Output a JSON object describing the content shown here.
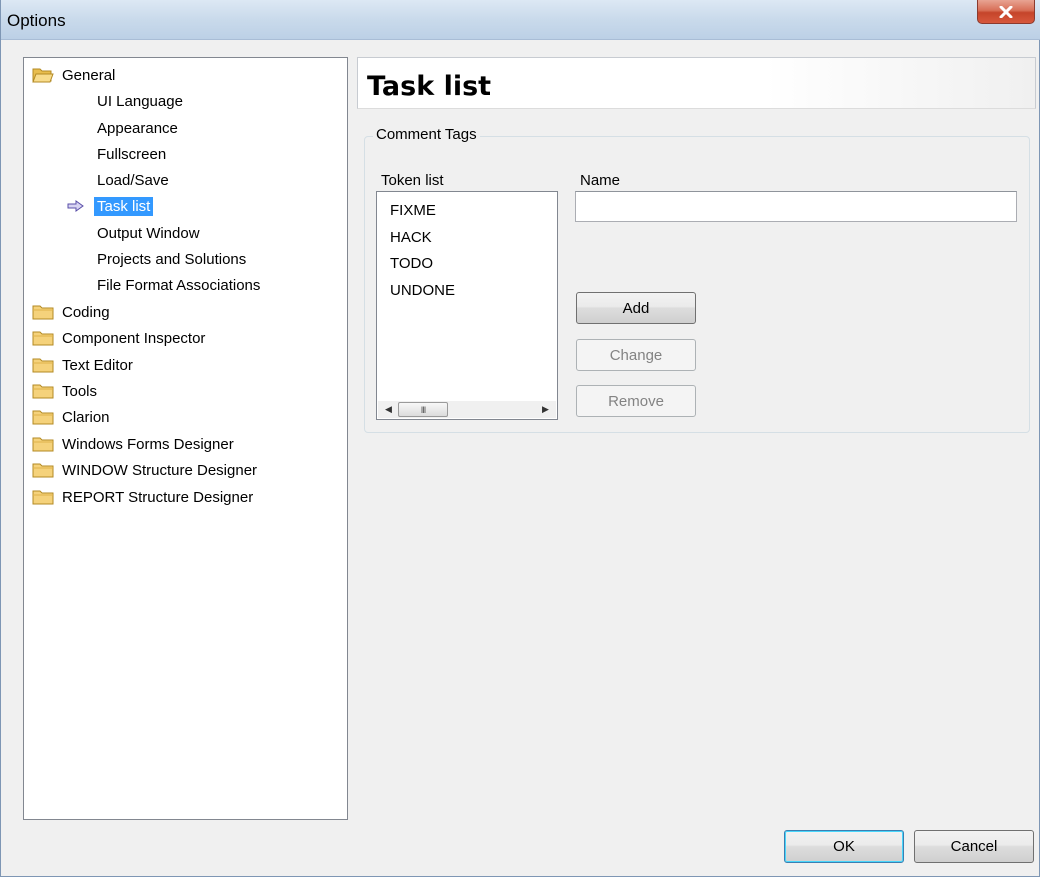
{
  "window": {
    "title": "Options"
  },
  "tree": {
    "general": {
      "label": "General",
      "children": [
        {
          "label": "UI Language"
        },
        {
          "label": "Appearance"
        },
        {
          "label": "Fullscreen"
        },
        {
          "label": "Load/Save"
        },
        {
          "label": "Task list",
          "selected": true
        },
        {
          "label": "Output Window"
        },
        {
          "label": "Projects and Solutions"
        },
        {
          "label": "File Format Associations"
        }
      ]
    },
    "folders": [
      {
        "label": "Coding"
      },
      {
        "label": "Component Inspector"
      },
      {
        "label": "Text Editor"
      },
      {
        "label": "Tools"
      },
      {
        "label": "Clarion"
      },
      {
        "label": "Windows Forms Designer"
      },
      {
        "label": "WINDOW Structure Designer"
      },
      {
        "label": "REPORT Structure Designer"
      }
    ]
  },
  "panel": {
    "title": "Task list",
    "group_label": "Comment Tags",
    "token_list_label": "Token list",
    "tokens": [
      "FIXME",
      "HACK",
      "TODO",
      "UNDONE"
    ],
    "name_label": "Name",
    "name_value": "",
    "add_label": "Add",
    "change_label": "Change",
    "remove_label": "Remove"
  },
  "footer": {
    "ok_label": "OK",
    "cancel_label": "Cancel"
  },
  "colors": {
    "selection": "#3399ff",
    "titlebar": "#c9daeb",
    "close": "#c5442a",
    "folder": "#f5d27b"
  },
  "icons": {
    "open_folder": "open-folder-icon",
    "folder": "folder-icon",
    "arrow": "right-arrow-icon",
    "close": "close-icon"
  }
}
